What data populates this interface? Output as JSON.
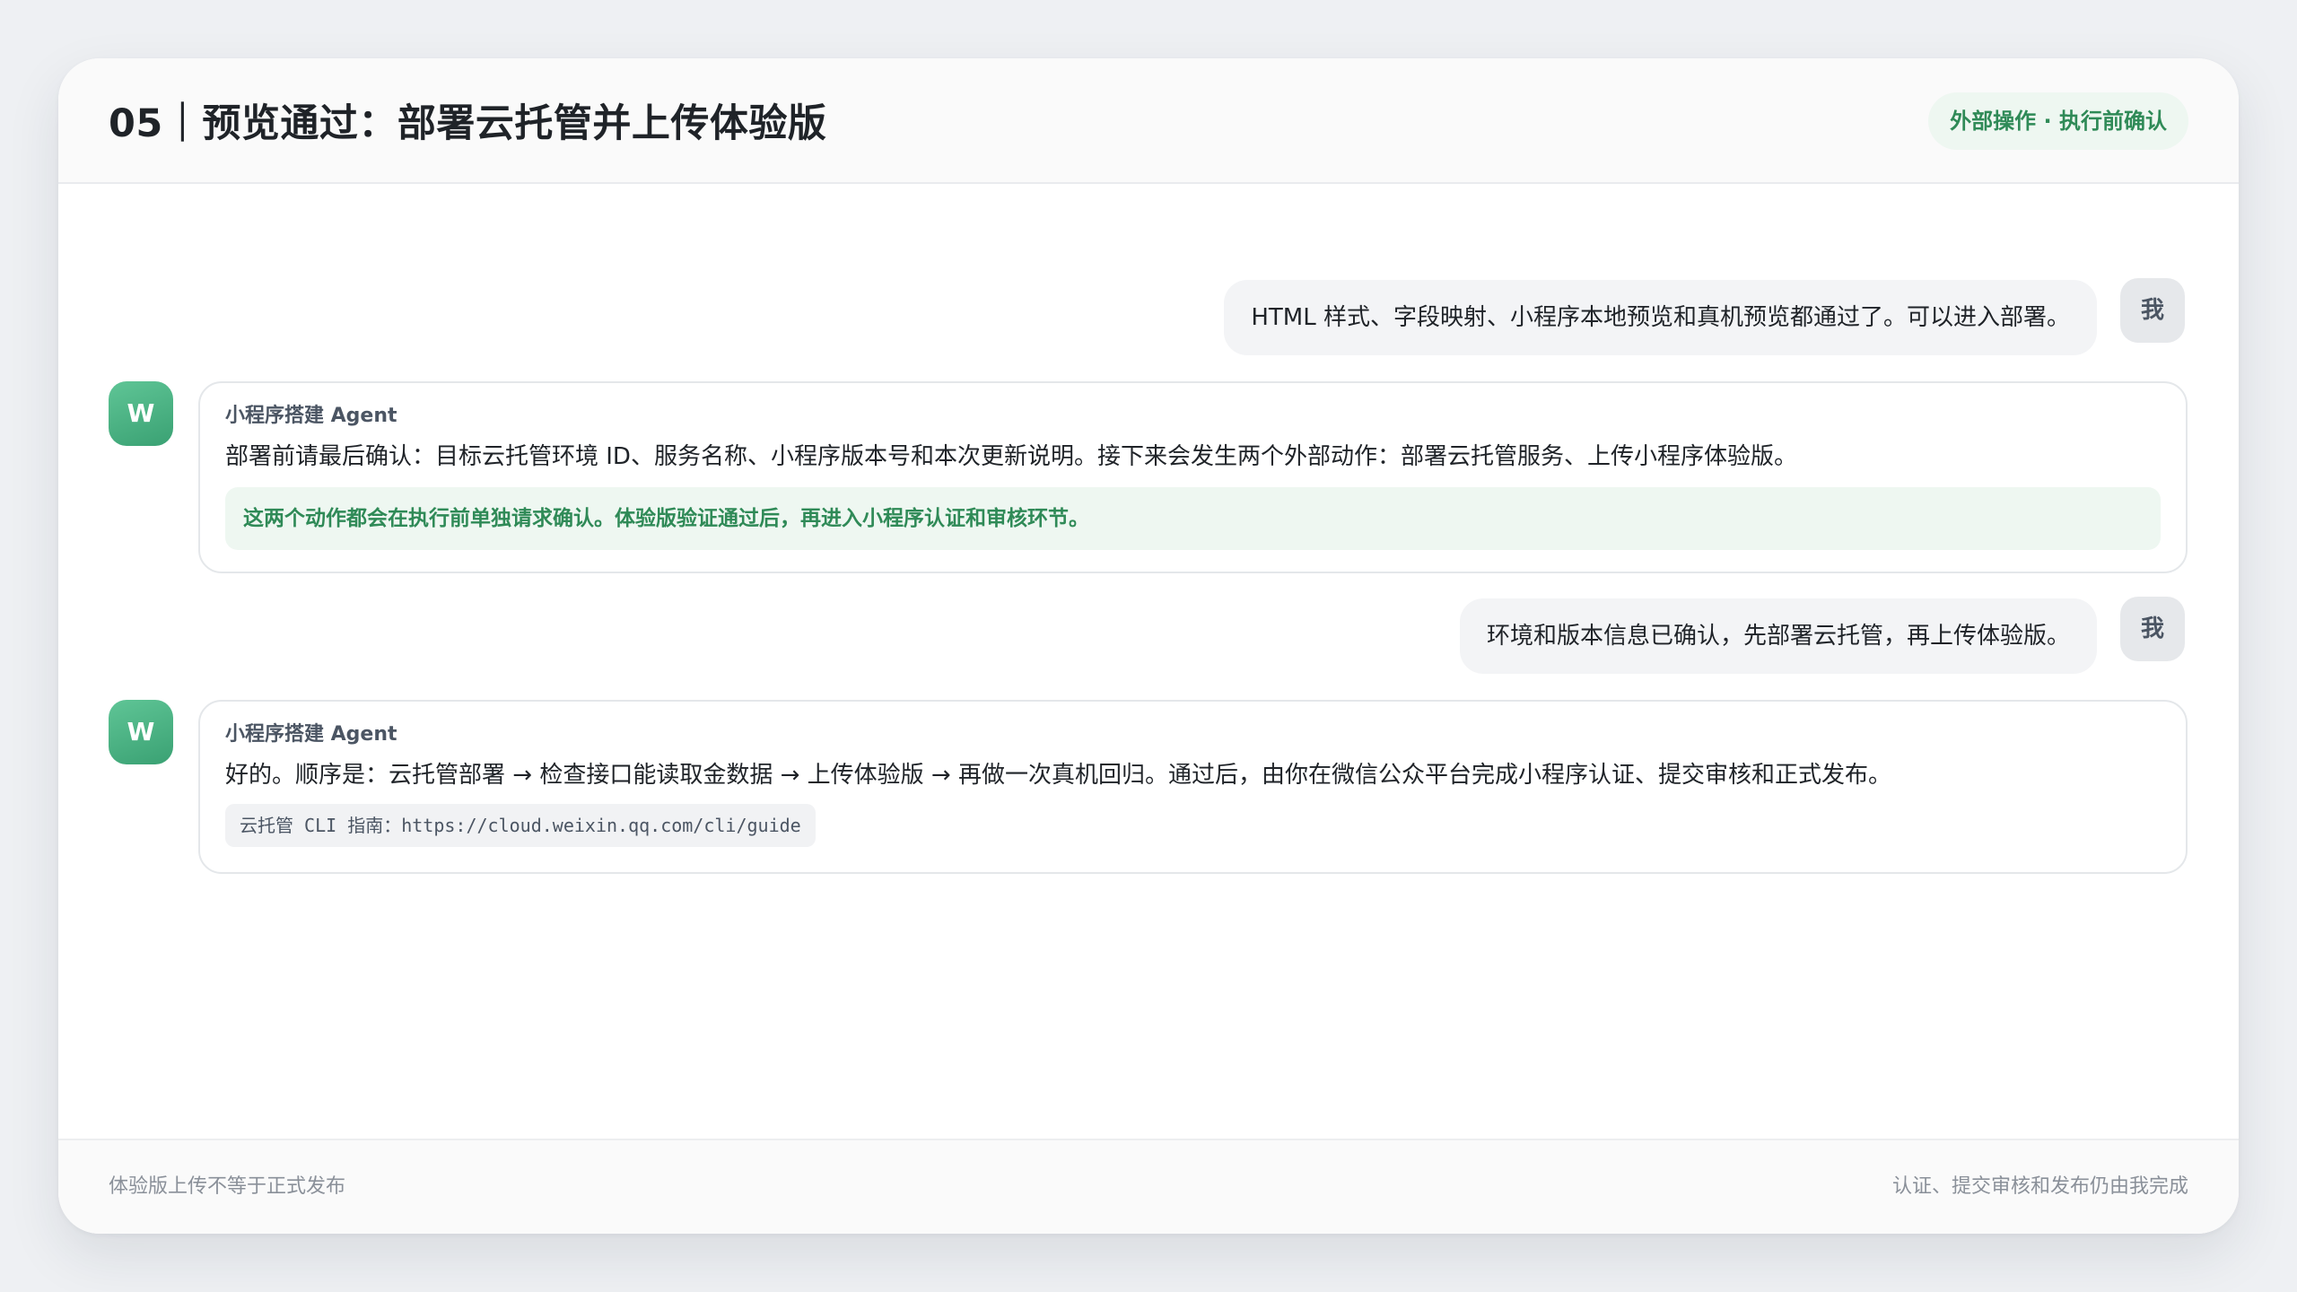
{
  "header": {
    "title": "05｜预览通过：部署云托管并上传体验版",
    "badge": "外部操作 · 执行前确认"
  },
  "messages": [
    {
      "role": "user",
      "avatar": "我",
      "text": "HTML 样式、字段映射、小程序本地预览和真机预览都通过了。可以进入部署。"
    },
    {
      "role": "agent",
      "avatar": "W",
      "name": "小程序搭建 Agent",
      "text": "部署前请最后确认：目标云托管环境 ID、服务名称、小程序版本号和本次更新说明。接下来会发生两个外部动作：部署云托管服务、上传小程序体验版。",
      "note": "这两个动作都会在执行前单独请求确认。体验版验证通过后，再进入小程序认证和审核环节。"
    },
    {
      "role": "user",
      "avatar": "我",
      "text": "环境和版本信息已确认，先部署云托管，再上传体验版。"
    },
    {
      "role": "agent",
      "avatar": "W",
      "name": "小程序搭建 Agent",
      "text": "好的。顺序是：云托管部署 → 检查接口能读取金数据 → 上传体验版 → 再做一次真机回归。通过后，由你在微信公众平台完成小程序认证、提交审核和正式发布。",
      "code": "云托管 CLI 指南：https://cloud.weixin.qq.com/cli/guide"
    }
  ],
  "footer": {
    "left": "体验版上传不等于正式发布",
    "right": "认证、提交审核和发布仍由我完成"
  },
  "colors": {
    "accent_green": "#2f8a57",
    "accent_green_bg": "#eef7f1",
    "agent_avatar": "#4db384"
  }
}
